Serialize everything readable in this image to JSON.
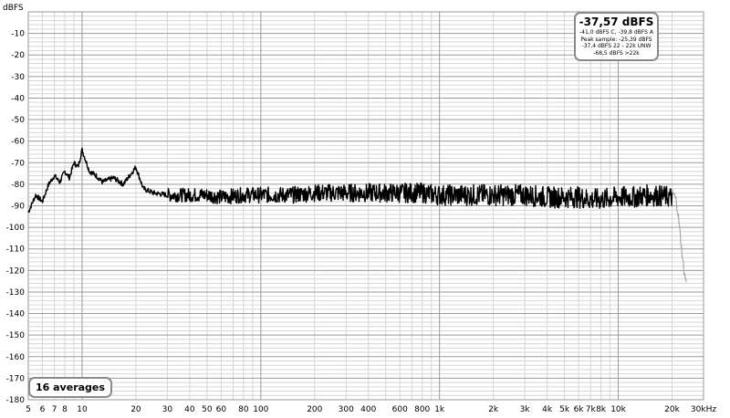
{
  "info": {
    "level": "-37,57 dBFS",
    "weighted": "-41,0 dBFS C, -39,8 dBFS A",
    "peak": "Peak sample: -25,39 dBFS",
    "unw": "-37,4 dBFS 22 - 22k UNW",
    "above": "-68,5 dBFS >22k"
  },
  "averages_label": "16 averages",
  "colors": {
    "trace": "#000000",
    "trace_above": "#a8a8a8",
    "grid_major": "#9a9a9a",
    "grid_minor": "#d6d6d6"
  },
  "chart_data": {
    "type": "line",
    "x_scale": "log",
    "xlim": [
      5,
      30000
    ],
    "ylim": [
      -180,
      0
    ],
    "yunit": "dBFS",
    "xunit": "kHz",
    "y_ticks": [
      -10,
      -20,
      -30,
      -40,
      -50,
      -60,
      -70,
      -80,
      -90,
      -100,
      -110,
      -120,
      -130,
      -140,
      -150,
      -160,
      -170,
      -180
    ],
    "y_tick_labels": [
      "-10",
      "-20",
      "-30",
      "-40",
      "-50",
      "-60",
      "-70",
      "-80",
      "-90",
      "-100",
      "-110",
      "-120",
      "-130",
      "-140",
      "-150",
      "-160",
      "-170",
      "-180"
    ],
    "x_ticks": [
      5,
      6,
      7,
      8,
      10,
      20,
      30,
      40,
      50,
      60,
      80,
      100,
      200,
      300,
      400,
      600,
      800,
      1000,
      2000,
      3000,
      4000,
      5000,
      6000,
      7000,
      8000,
      10000,
      20000,
      30000
    ],
    "x_tick_labels": [
      "5",
      "6",
      "7",
      "8",
      "10",
      "20",
      "30",
      "40",
      "50",
      "60",
      "80",
      "100",
      "200",
      "300",
      "400",
      "600",
      "800",
      "1k",
      "2k",
      "3k",
      "4k",
      "5k",
      "6k",
      "7k",
      "8k",
      "10k",
      "20k",
      "30k"
    ],
    "grid": true,
    "series": [
      {
        "x": [
          5,
          5.5,
          6,
          6.5,
          7,
          7.5,
          8,
          8.5,
          9,
          9.5,
          10,
          11,
          12,
          13,
          15,
          17,
          20,
          22,
          25,
          30,
          40,
          50,
          60,
          80,
          100,
          150,
          200,
          300,
          400,
          600,
          800,
          1000,
          1500,
          2000,
          3000,
          4000,
          5000,
          6000,
          7000,
          8000,
          10000,
          12000,
          15000,
          20000
        ],
        "y": [
          -93,
          -85,
          -88,
          -80,
          -76,
          -79,
          -74,
          -77,
          -70,
          -72,
          -64,
          -74,
          -76,
          -79,
          -77,
          -80,
          -72,
          -82,
          -84,
          -85,
          -85,
          -85,
          -86,
          -85,
          -85,
          -85,
          -84,
          -84,
          -84,
          -84,
          -84,
          -85,
          -85,
          -85,
          -85,
          -86,
          -86,
          -86,
          -87,
          -87,
          -86,
          -86,
          -85,
          -86
        ]
      },
      {
        "x": [
          20000,
          20500,
          21000,
          21500,
          22000,
          22500,
          23000,
          23500,
          24000
        ],
        "y": [
          -84,
          -85,
          -87,
          -92,
          -100,
          -108,
          -116,
          -122,
          -125
        ]
      }
    ]
  }
}
